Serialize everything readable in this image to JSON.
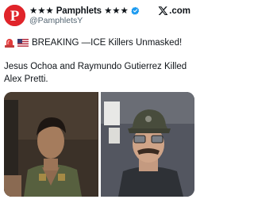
{
  "account": {
    "display_name": "★★★ Pamphlets ★★★",
    "handle": "@PamphletsY",
    "avatar_letter": "P",
    "verified": true
  },
  "brand": {
    "dotcom": ".com"
  },
  "tweet": {
    "line1": "BREAKING —ICE Killers Unmasked!",
    "line2": "Jesus Ochoa and Raymundo Gutierrez Killed Alex Pretti."
  },
  "icons": [
    "siren-icon",
    "us-flag-icon",
    "verified-badge-icon",
    "x-logo-icon"
  ],
  "colors": {
    "avatar": "#e0242a",
    "verified": "#1d9bf0",
    "text": "#0f1419",
    "secondary": "#536471"
  }
}
